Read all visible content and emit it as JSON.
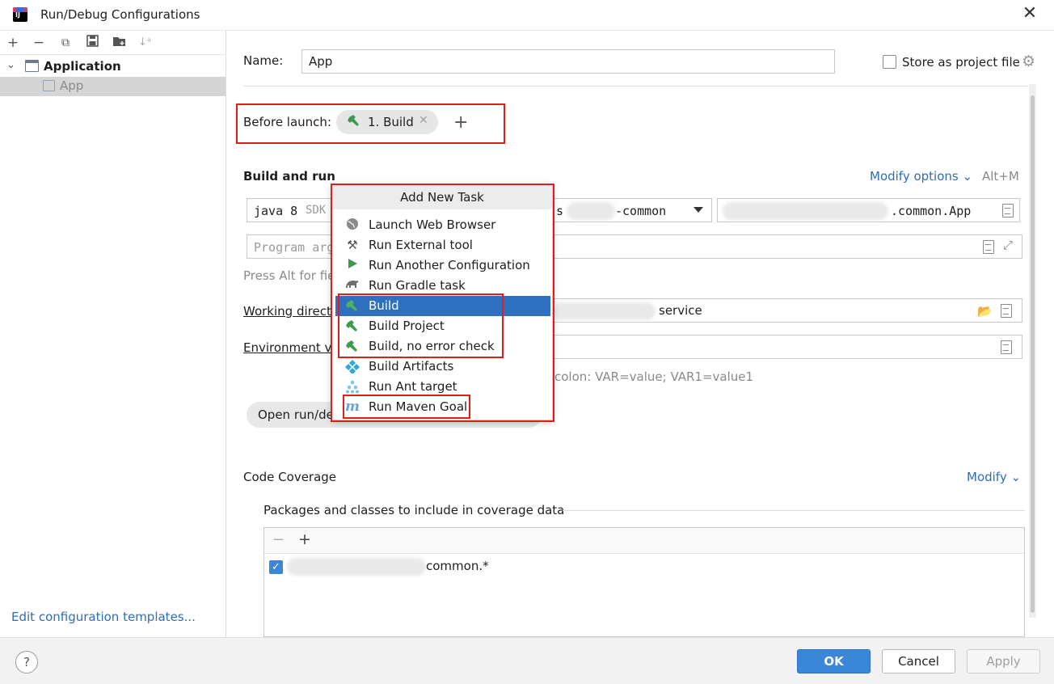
{
  "window": {
    "title": "Run/Debug Configurations",
    "logo_text": "IJ"
  },
  "left": {
    "toolbar_icons": [
      "add-icon",
      "remove-icon",
      "copy-icon",
      "save-icon",
      "folder-icon",
      "sort-icon"
    ],
    "tree": {
      "group": "Application",
      "child": "App"
    },
    "edit_templates": "Edit configuration templates..."
  },
  "form": {
    "name_label": "Name:",
    "name_value": "App",
    "store_label": "Store as project file",
    "before_launch_label": "Before launch:",
    "before_launch_task": "1. Build",
    "build_run_label": "Build and run",
    "modify_options": "Modify options",
    "modify_shortcut": "Alt+M",
    "sdk_value": "java 8",
    "sdk_hint": "SDK",
    "module_prefix": "s",
    "module_value": "-common",
    "main_class": ".common.App",
    "program_args_placeholder": "Program arg",
    "press_alt_hint": "Press Alt for fie",
    "working_dir_label": "Working direct",
    "working_dir_value": "service",
    "env_label": "Environment va",
    "env_hint": "colon: VAR=value; VAR1=value1",
    "open_run_label": "Open run/de",
    "code_coverage_label": "Code Coverage",
    "modify_label": "Modify",
    "coverage_section_label": "Packages and classes to include in coverage data",
    "coverage_item": "common.*"
  },
  "popup": {
    "title": "Add New Task",
    "items": [
      {
        "label": "Launch Web Browser",
        "icon": "globe-icon"
      },
      {
        "label": "Run External tool",
        "icon": "tools-icon"
      },
      {
        "label": "Run Another Configuration",
        "icon": "run-icon"
      },
      {
        "label": "Run Gradle task",
        "icon": "gradle-icon"
      },
      {
        "label": "Build",
        "icon": "hammer-icon"
      },
      {
        "label": "Build Project",
        "icon": "hammer-icon"
      },
      {
        "label": "Build, no error check",
        "icon": "hammer-icon"
      },
      {
        "label": "Build Artifacts",
        "icon": "artifacts-icon"
      },
      {
        "label": "Run Ant target",
        "icon": "ant-icon"
      },
      {
        "label": "Run Maven Goal",
        "icon": "maven-icon"
      }
    ]
  },
  "buttons": {
    "ok": "OK",
    "cancel": "Cancel",
    "apply": "Apply",
    "help": "?"
  },
  "colors": {
    "accent": "#3a86d9",
    "selection": "#2f6fc0",
    "highlight_box": "#e31d1d",
    "link": "#2e6eb5"
  }
}
